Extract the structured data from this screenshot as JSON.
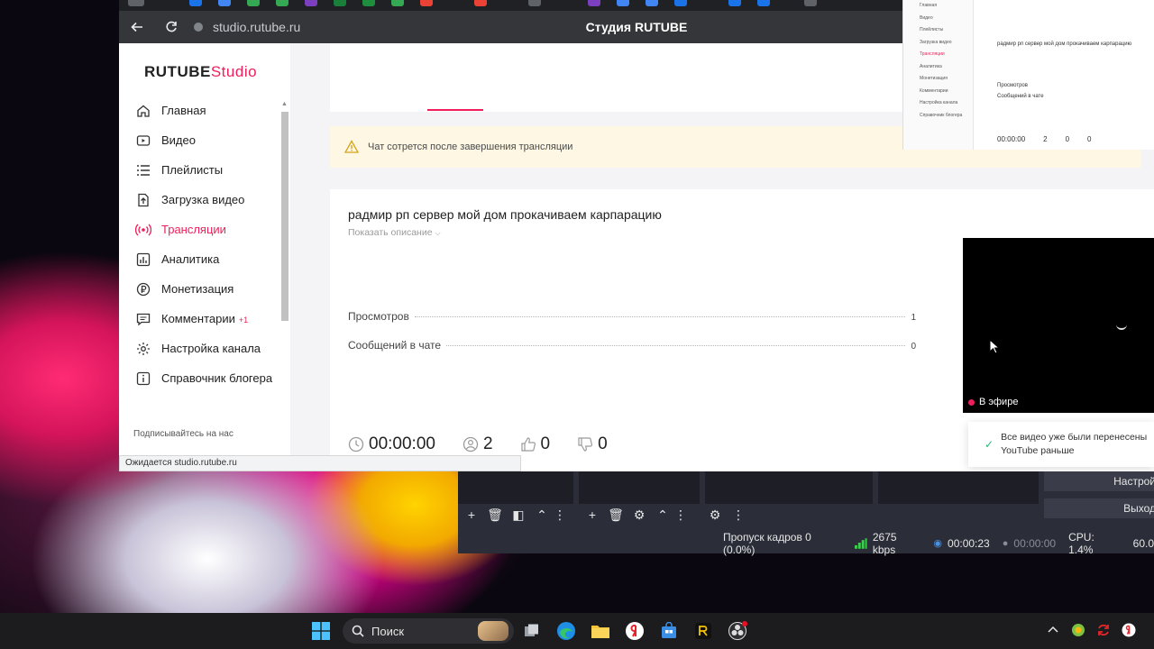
{
  "browser": {
    "url": "studio.rutube.ru",
    "page_title": "Студия RUTUBE",
    "status_url": "Ожидается studio.rutube.ru"
  },
  "logo": {
    "part1": "RUTUBE",
    "part2": "Studio"
  },
  "sidebar": {
    "items": [
      {
        "label": "Главная",
        "icon": "home-icon"
      },
      {
        "label": "Видео",
        "icon": "video-icon"
      },
      {
        "label": "Плейлисты",
        "icon": "playlist-icon"
      },
      {
        "label": "Загрузка видео",
        "icon": "upload-icon"
      },
      {
        "label": "Трансляции",
        "icon": "broadcast-icon",
        "active": true
      },
      {
        "label": "Аналитика",
        "icon": "analytics-icon"
      },
      {
        "label": "Монетизация",
        "icon": "monetization-icon"
      },
      {
        "label": "Комментарии",
        "icon": "comments-icon",
        "badge": "+1"
      },
      {
        "label": "Настройка канала",
        "icon": "gear-icon"
      },
      {
        "label": "Справочник блогера",
        "icon": "info-icon"
      }
    ],
    "subscribe": "Подписывайтесь на нас"
  },
  "warning": {
    "text": "Чат сотрется после завершения трансляции"
  },
  "stream": {
    "title": "радмир рп сервер мой дом прокачиваем карпарацию",
    "show_description": "Показать описание",
    "views_label": "Просмотров",
    "views_value": "1",
    "chat_label": "Сообщений в чате",
    "chat_value": "0",
    "duration": "00:00:00",
    "viewers": "2",
    "likes": "0",
    "dislikes": "0"
  },
  "player": {
    "live_label": "В эфире"
  },
  "toast": {
    "line1": "Все видео уже были перенесены",
    "line2": "YouTube раньше"
  },
  "preview": {
    "title": "радмир рп сервер мой дом прокачиваем карпарацию",
    "views": "Просмотров",
    "chat": "Сообщений в чате",
    "duration": "00:00:00",
    "viewers": "2",
    "likes": "0",
    "dislikes": "0"
  },
  "obs": {
    "settings_label": "Настрой",
    "exit_label": "Выход",
    "dropped_frames": "Пропуск кадров 0 (0.0%)",
    "bitrate": "2675 kbps",
    "stream_time": "00:00:23",
    "record_time": "00:00:00",
    "cpu": "CPU: 1.4%",
    "fps": "60.0"
  },
  "taskbar": {
    "search_label": "Поиск"
  },
  "colors": {
    "accent": "#ee1f5a",
    "warning_bg": "#fdf7e3",
    "obs_bg": "#2b2e38",
    "taskbar_bg": "#1c1c1f"
  }
}
